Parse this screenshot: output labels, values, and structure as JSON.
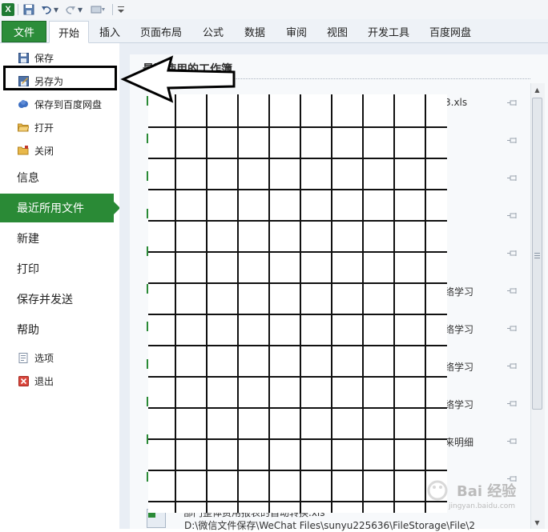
{
  "quick_access": {
    "logo_letter": "X",
    "undo_arrow": "▾",
    "redo_arrow": "▾"
  },
  "tabs": {
    "file": "文件",
    "items": [
      "开始",
      "插入",
      "页面布局",
      "公式",
      "数据",
      "审阅",
      "视图",
      "开发工具",
      "百度网盘"
    ],
    "active": "开始"
  },
  "nav": {
    "save": "保存",
    "save_as": "另存为",
    "save_to_baidu": "保存到百度网盘",
    "open": "打开",
    "close": "关闭",
    "info": "信息",
    "recent": "最近所用文件",
    "new": "新建",
    "print": "打印",
    "save_send": "保存并发送",
    "help": "帮助",
    "options": "选项",
    "exit": "退出"
  },
  "recent": {
    "title": "最近使用的工作簿",
    "items": [
      {
        "name": "3.xls"
      },
      {
        "name": ""
      },
      {
        "name": ""
      },
      {
        "name": ""
      },
      {
        "name": ""
      },
      {
        "name": "络学习"
      },
      {
        "name": "络学习"
      },
      {
        "name": "络学习"
      },
      {
        "name": "络学习"
      },
      {
        "name": "来明细"
      },
      {
        "name": ""
      }
    ],
    "bottom_line1": "部门整体费用报表的自动转换.xls",
    "bottom_line2": "D:\\微信文件保存\\WeChat Files\\sunyu225636\\FileStorage\\File\\2"
  },
  "watermark": {
    "text": "Bai 经验",
    "url": "jingyan.baidu.com"
  },
  "colors": {
    "accent_green": "#2a8a36",
    "highlight_box": "#000000"
  }
}
